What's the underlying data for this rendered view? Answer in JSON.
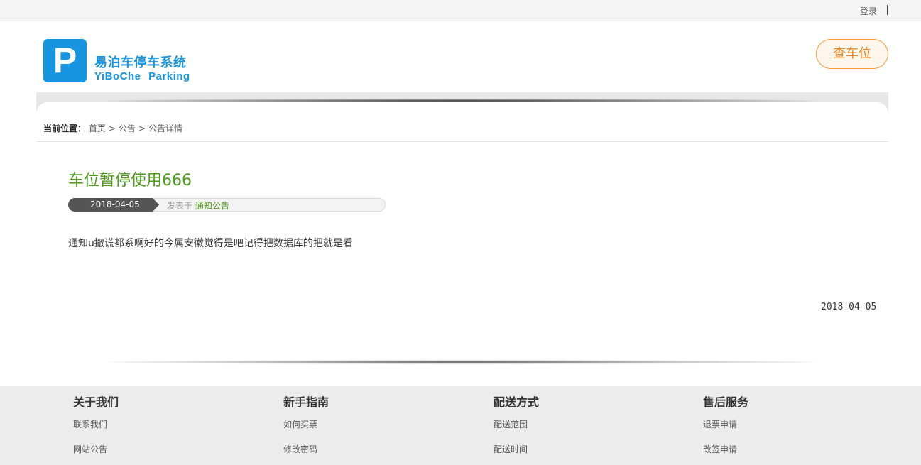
{
  "topbar": {
    "login": "登录"
  },
  "header": {
    "logo_letter": "P",
    "site_name_cn": "易泊车停车系统",
    "site_name_en": "YiBoChe  Parking",
    "find_button": "查车位",
    "brand_color": "#1795e0",
    "accent_color": "#f08319"
  },
  "breadcrumb": {
    "label": "当前位置：",
    "items": [
      "首页",
      "公告",
      "公告详情"
    ],
    "separator": ">"
  },
  "article": {
    "title": "车位暂停使用666",
    "date": "2018-04-05",
    "posted_in": "发表于",
    "category": "通知公告",
    "body": "通知u撤谎都系啊好的今属安徽觉得是吧记得把数据库的把就是看",
    "footer_date": "2018-04-05",
    "title_color": "#4b9a1a"
  },
  "footer": {
    "columns": [
      {
        "heading": "关于我们",
        "links": [
          "联系我们",
          "网站公告"
        ]
      },
      {
        "heading": "新手指南",
        "links": [
          "如何买票",
          "修改密码"
        ]
      },
      {
        "heading": "配送方式",
        "links": [
          "配送范围",
          "配送时间"
        ]
      },
      {
        "heading": "售后服务",
        "links": [
          "退票申请",
          "改签申请"
        ]
      }
    ]
  }
}
